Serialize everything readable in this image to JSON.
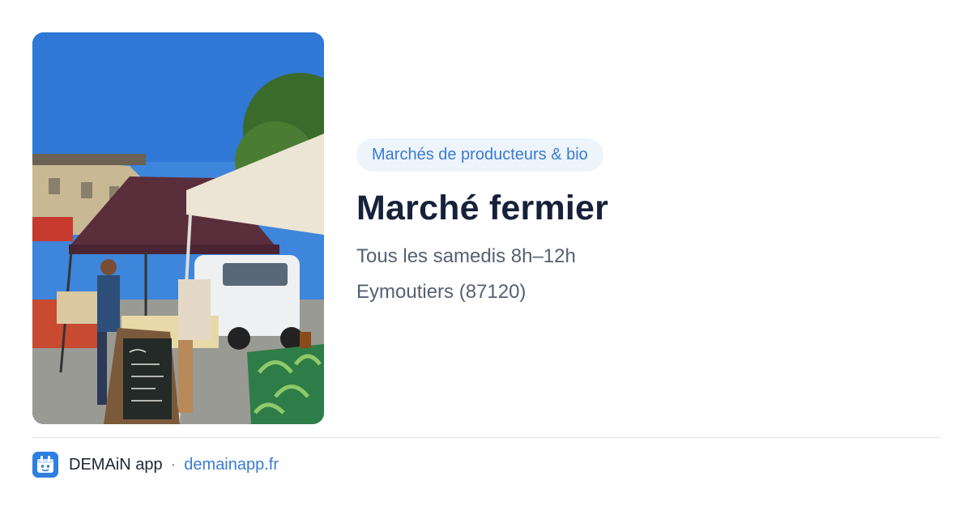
{
  "event": {
    "category": "Marchés de producteurs & bio",
    "title": "Marché fermier",
    "schedule": "Tous les samedis 8h–12h",
    "location": "Eymoutiers (87120)"
  },
  "footer": {
    "app_name": "DEMAiN app",
    "separator": "·",
    "url": "demainapp.fr"
  },
  "colors": {
    "accent": "#3a7bd0",
    "badge_bg": "#edf4fc",
    "title": "#16213a",
    "muted": "#566071"
  },
  "icons": {
    "app": "demain-app-logo-icon"
  }
}
